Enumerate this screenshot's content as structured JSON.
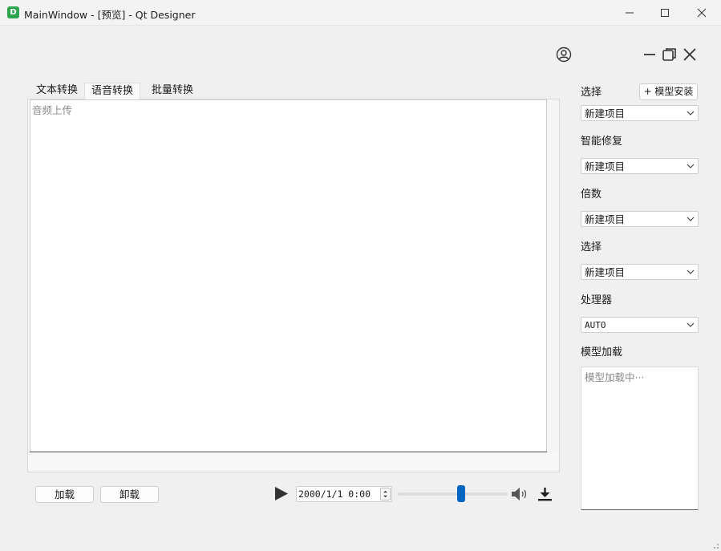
{
  "window": {
    "title": "MainWindow - [预览] - Qt Designer",
    "app_icon_letter": "D"
  },
  "tabs": [
    {
      "label": "文本转换"
    },
    {
      "label": "语音转换",
      "selected": true
    },
    {
      "label": "批量转换"
    }
  ],
  "audio_area": {
    "label": "音频上传"
  },
  "buttons": {
    "load": "加载",
    "unload": "卸载",
    "install_model": "+ 模型安装"
  },
  "player": {
    "datetime": "2000/1/1 0:00",
    "slider_fraction": 0.58
  },
  "settings": {
    "select1": {
      "label": "选择",
      "value": "新建项目"
    },
    "repair": {
      "label": "智能修复",
      "value": "新建项目"
    },
    "multiplier": {
      "label": "倍数",
      "value": "新建项目"
    },
    "select2": {
      "label": "选择",
      "value": "新建项目"
    },
    "processor": {
      "label": "处理器",
      "value": "AUTO"
    },
    "model_loading": {
      "label": "模型加载",
      "placeholder": "模型加载中···"
    }
  },
  "icons": {
    "user": "user-circle-icon",
    "play": "play-icon",
    "volume": "volume-icon",
    "download": "download-icon"
  },
  "colors": {
    "accent": "#0067c0",
    "app_icon": "#2ea44f"
  }
}
